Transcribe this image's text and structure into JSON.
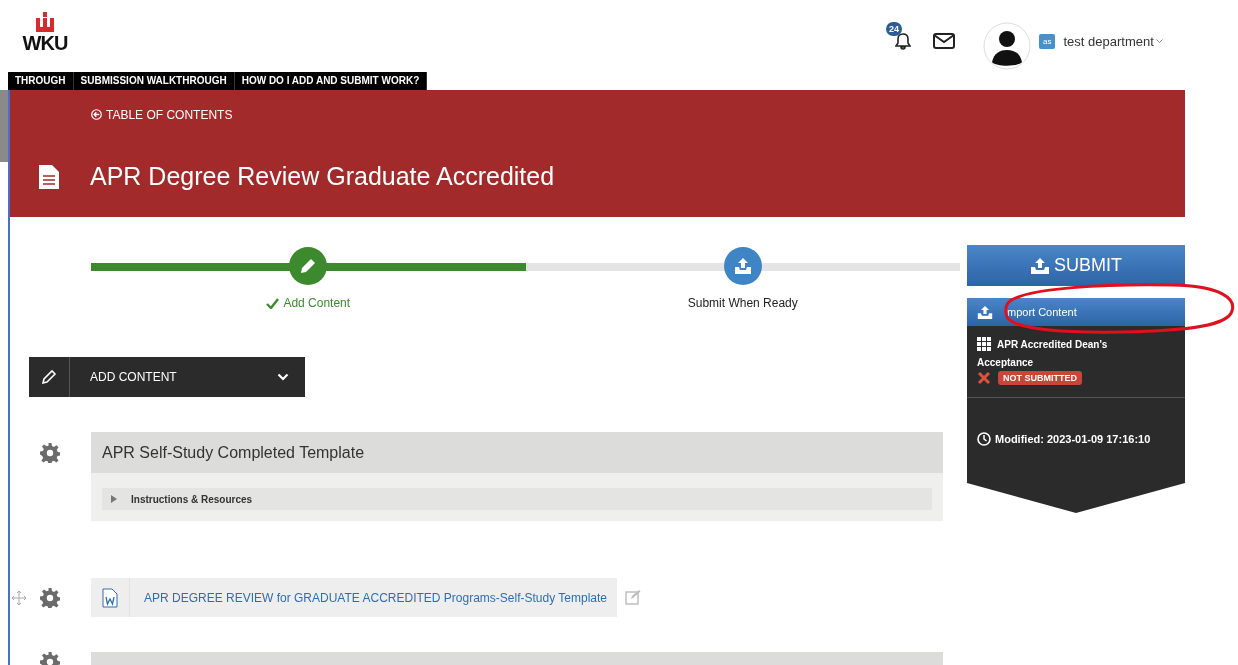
{
  "logo": {
    "text": "WKU"
  },
  "header": {
    "notification_count": "24",
    "user_initials": "as",
    "user_name": "test department"
  },
  "nav_links": [
    {
      "label": "THROUGH"
    },
    {
      "label": "SUBMISSION WALKTHROUGH"
    },
    {
      "label": "HOW DO I ADD AND SUBMIT WORK?"
    }
  ],
  "banner": {
    "back_link": "TABLE OF CONTENTS",
    "title": "APR Degree Review Graduate Accredited"
  },
  "progress": {
    "level": 0.5,
    "steps": [
      {
        "label": "Add Content",
        "completed": true
      },
      {
        "label": "Submit When Ready",
        "completed": false
      }
    ]
  },
  "add_content": {
    "label": "ADD CONTENT"
  },
  "items": [
    {
      "kind": "section",
      "title": "APR Self-Study Completed Template",
      "expandable": {
        "label": "Instructions & Resources",
        "expanded": false
      }
    },
    {
      "kind": "file",
      "title": "APR DEGREE REVIEW for GRADUATE ACCREDITED Programs-Self-Study Template"
    },
    {
      "kind": "section"
    }
  ],
  "submit_panel": {
    "button": "SUBMIT",
    "import_label": "mport Content",
    "requirement": {
      "title": "APR Accredited Dean's",
      "title_line2": "Acceptance",
      "status": "NOT SUBMITTED",
      "submitted": false
    },
    "modified": "Modified: 2023-01-09 17:16:10"
  },
  "annotation": {
    "kind": "ellipse"
  }
}
